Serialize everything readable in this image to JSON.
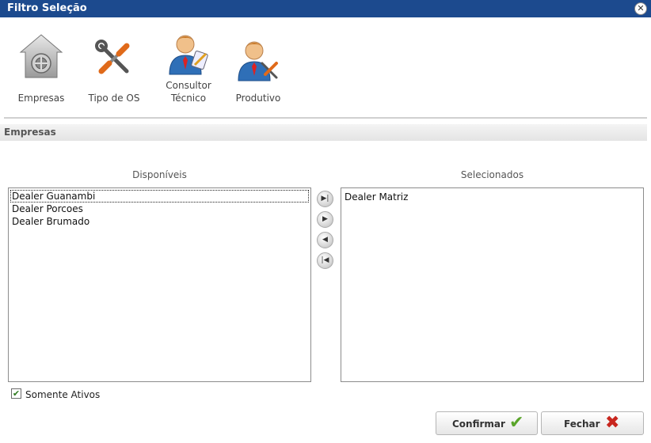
{
  "window": {
    "title": "Filtro Seleção",
    "close_symbol": "✕"
  },
  "toolbar": {
    "items": [
      {
        "label": "Empresas",
        "icon": "safe-house-icon"
      },
      {
        "label": "Tipo de OS",
        "icon": "tools-icon"
      },
      {
        "label": "Consultor Técnico",
        "label_line1": "Consultor",
        "label_line2": "Técnico",
        "icon": "consultant-person-icon"
      },
      {
        "label": "Produtivo",
        "icon": "mechanic-person-icon"
      }
    ]
  },
  "section": {
    "title": "Empresas"
  },
  "available": {
    "title": "Disponíveis",
    "items": [
      "Dealer Guanambi",
      "Dealer Porcoes",
      "Dealer Brumado"
    ]
  },
  "selected": {
    "title": "Selecionados",
    "items": [
      "Dealer Matriz"
    ]
  },
  "move_buttons": {
    "add_all": "▶|",
    "add": "▶",
    "remove": "◀",
    "remove_all": "|◀"
  },
  "filter": {
    "only_active_label": "Somente Ativos",
    "only_active_checked": true,
    "check_symbol": "✔"
  },
  "actions": {
    "confirm_label": "Confirmar",
    "confirm_symbol": "✔",
    "close_label": "Fechar",
    "close_symbol": "✖"
  },
  "colors": {
    "titlebar": "#1c4a8e",
    "confirm_icon": "#5aa52a",
    "close_icon": "#c8261e"
  }
}
